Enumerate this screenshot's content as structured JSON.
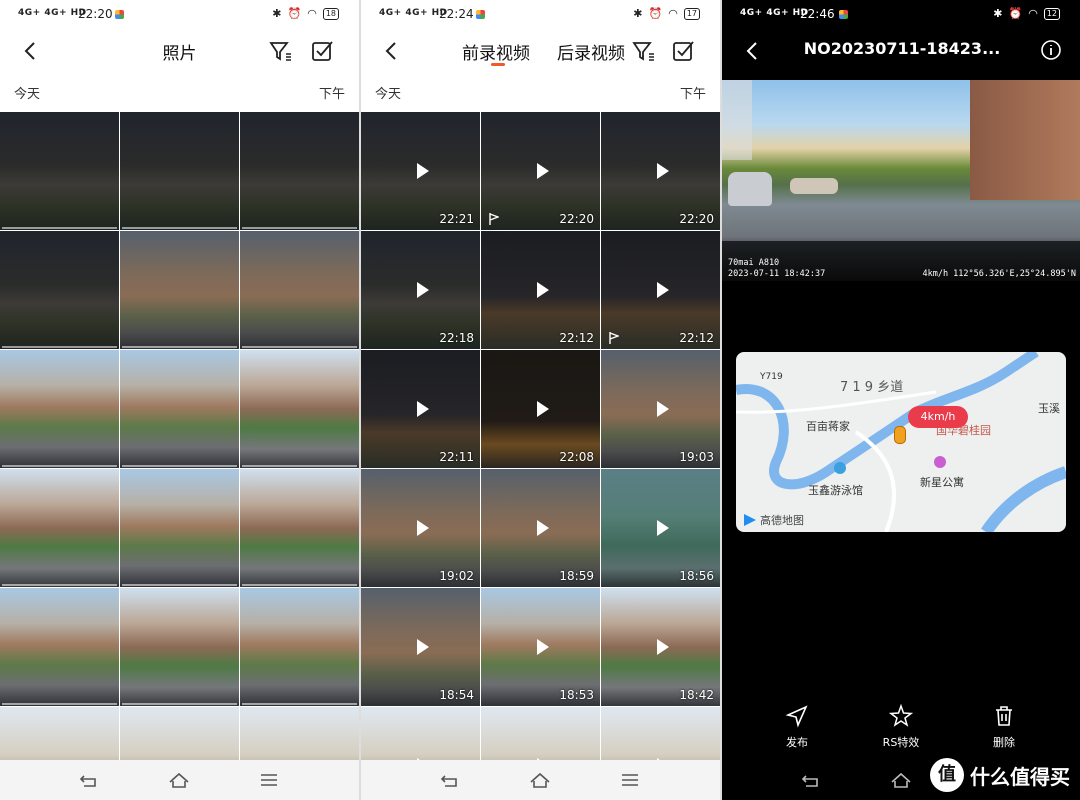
{
  "panel1": {
    "status": {
      "signal": "4G+ 4G+ HD",
      "time": "22:20",
      "battery": "18"
    },
    "title": "照片",
    "date_label": "今天",
    "period_label": "下午",
    "thumbs": [
      {
        "bg": "bg-night"
      },
      {
        "bg": "bg-night"
      },
      {
        "bg": "bg-night"
      },
      {
        "bg": "bg-night"
      },
      {
        "bg": "bg-dusk"
      },
      {
        "bg": "bg-dusk"
      },
      {
        "bg": "bg-day"
      },
      {
        "bg": "bg-day"
      },
      {
        "bg": "bg-day2"
      },
      {
        "bg": "bg-day2"
      },
      {
        "bg": "bg-day"
      },
      {
        "bg": "bg-day2"
      },
      {
        "bg": "bg-day"
      },
      {
        "bg": "bg-day2"
      },
      {
        "bg": "bg-day"
      },
      {
        "bg": "bg-sky"
      },
      {
        "bg": "bg-sky"
      },
      {
        "bg": "bg-sky"
      }
    ]
  },
  "panel2": {
    "status": {
      "signal": "4G+ 4G+ HD",
      "time": "22:24",
      "battery": "17"
    },
    "tab_front": "前录视频",
    "tab_rear": "后录视频",
    "date_label": "今天",
    "period_label": "下午",
    "videos": [
      {
        "bg": "bg-night",
        "duration": "22:21",
        "flag": false
      },
      {
        "bg": "bg-night",
        "duration": "22:20",
        "flag": true
      },
      {
        "bg": "bg-night",
        "duration": "22:20",
        "flag": false
      },
      {
        "bg": "bg-night",
        "duration": "22:18",
        "flag": false
      },
      {
        "bg": "bg-night2",
        "duration": "22:12",
        "flag": false
      },
      {
        "bg": "bg-night2",
        "duration": "22:12",
        "flag": true
      },
      {
        "bg": "bg-night2",
        "duration": "22:11",
        "flag": false
      },
      {
        "bg": "bg-dark",
        "duration": "22:08",
        "flag": false
      },
      {
        "bg": "bg-dusk",
        "duration": "19:03",
        "flag": false
      },
      {
        "bg": "bg-dusk",
        "duration": "19:02",
        "flag": false
      },
      {
        "bg": "bg-dusk",
        "duration": "18:59",
        "flag": false
      },
      {
        "bg": "bg-teal",
        "duration": "18:56",
        "flag": false
      },
      {
        "bg": "bg-dusk",
        "duration": "18:54",
        "flag": false
      },
      {
        "bg": "bg-day",
        "duration": "18:53",
        "flag": false
      },
      {
        "bg": "bg-day2",
        "duration": "18:42",
        "flag": false
      },
      {
        "bg": "bg-sky",
        "duration": "",
        "flag": false
      },
      {
        "bg": "bg-sky",
        "duration": "",
        "flag": false
      },
      {
        "bg": "bg-sky",
        "duration": "",
        "flag": false
      }
    ]
  },
  "panel3": {
    "status": {
      "signal": "4G+ 4G+ HD",
      "time": "22:46",
      "battery": "12"
    },
    "title": "NO20230711-18423...",
    "osd_brand": "70mai A810",
    "osd_datetime": "2023-07-11 18:42:37",
    "osd_gps": "4km/h   112°56.326'E,25°24.895'N",
    "map": {
      "road_label": "Y719",
      "village_road": "7 1 9 乡道",
      "place1": "百亩蒋家",
      "place2": "玉鑫游泳馆",
      "place3": "新星公寓",
      "place4": "玉溪",
      "place5": "国华碧桂园",
      "speed": "4km/h",
      "provider": "高德地图"
    },
    "actions": {
      "publish": "发布",
      "effects": "RS特效",
      "delete": "删除"
    },
    "watermark": {
      "logo": "值",
      "text": "什么值得买"
    }
  }
}
